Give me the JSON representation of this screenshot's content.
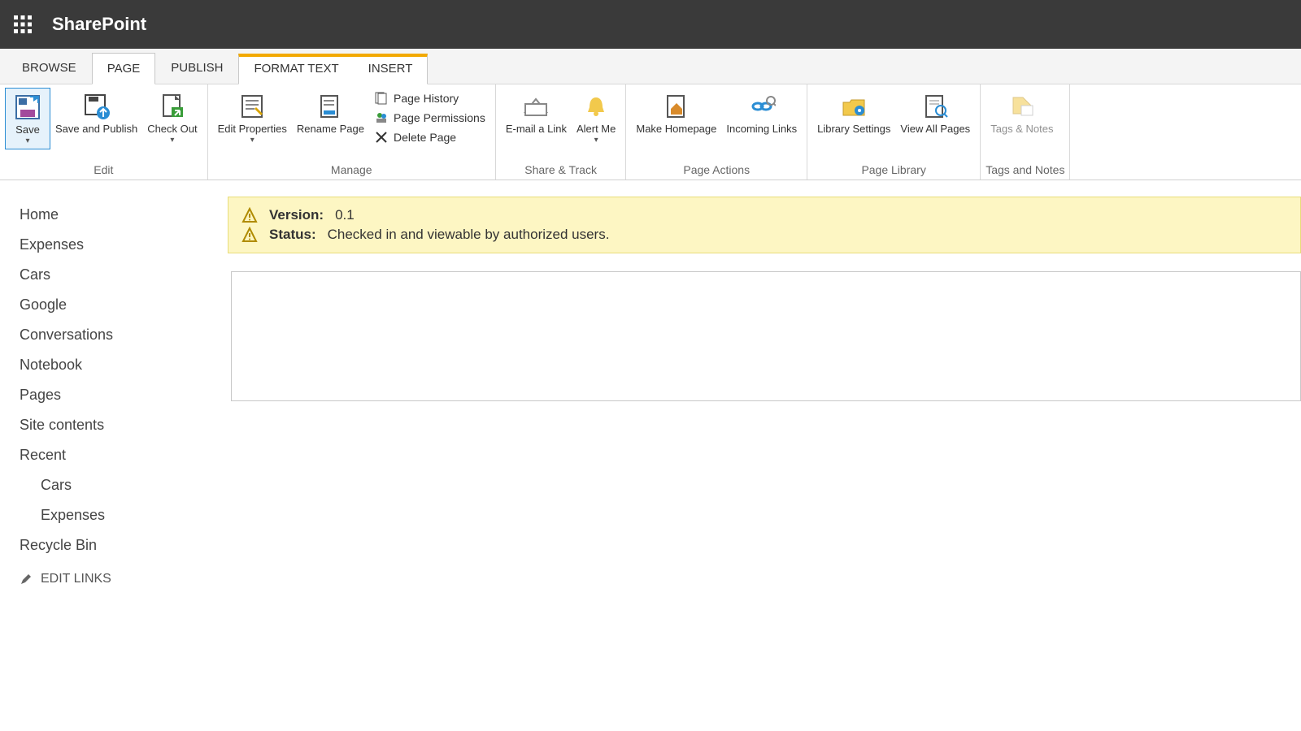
{
  "header": {
    "brand": "SharePoint"
  },
  "tabs": {
    "browse": "BROWSE",
    "page": "PAGE",
    "publish": "PUBLISH",
    "format_text": "FORMAT TEXT",
    "insert": "INSERT"
  },
  "ribbon": {
    "edit": {
      "label": "Edit",
      "save": "Save",
      "save_publish": "Save and Publish",
      "check_out": "Check Out"
    },
    "manage": {
      "label": "Manage",
      "edit_properties": "Edit Properties",
      "rename_page": "Rename Page",
      "page_history": "Page History",
      "page_permissions": "Page Permissions",
      "delete_page": "Delete Page"
    },
    "share_track": {
      "label": "Share & Track",
      "email_link": "E-mail a Link",
      "alert_me": "Alert Me"
    },
    "page_actions": {
      "label": "Page Actions",
      "make_homepage": "Make Homepage",
      "incoming_links": "Incoming Links"
    },
    "page_library": {
      "label": "Page Library",
      "library_settings": "Library Settings",
      "view_all_pages": "View All Pages"
    },
    "tags_notes": {
      "label": "Tags and Notes",
      "tags_notes_btn": "Tags & Notes"
    }
  },
  "nav": {
    "items": [
      "Home",
      "Expenses",
      "Cars",
      "Google",
      "Conversations",
      "Notebook",
      "Pages",
      "Site contents",
      "Recent"
    ],
    "recent_children": [
      "Cars",
      "Expenses"
    ],
    "recycle": "Recycle Bin",
    "edit_links": "EDIT LINKS"
  },
  "status": {
    "version_label": "Version:",
    "version_value": "0.1",
    "status_label": "Status:",
    "status_value": "Checked in and viewable by authorized users."
  }
}
